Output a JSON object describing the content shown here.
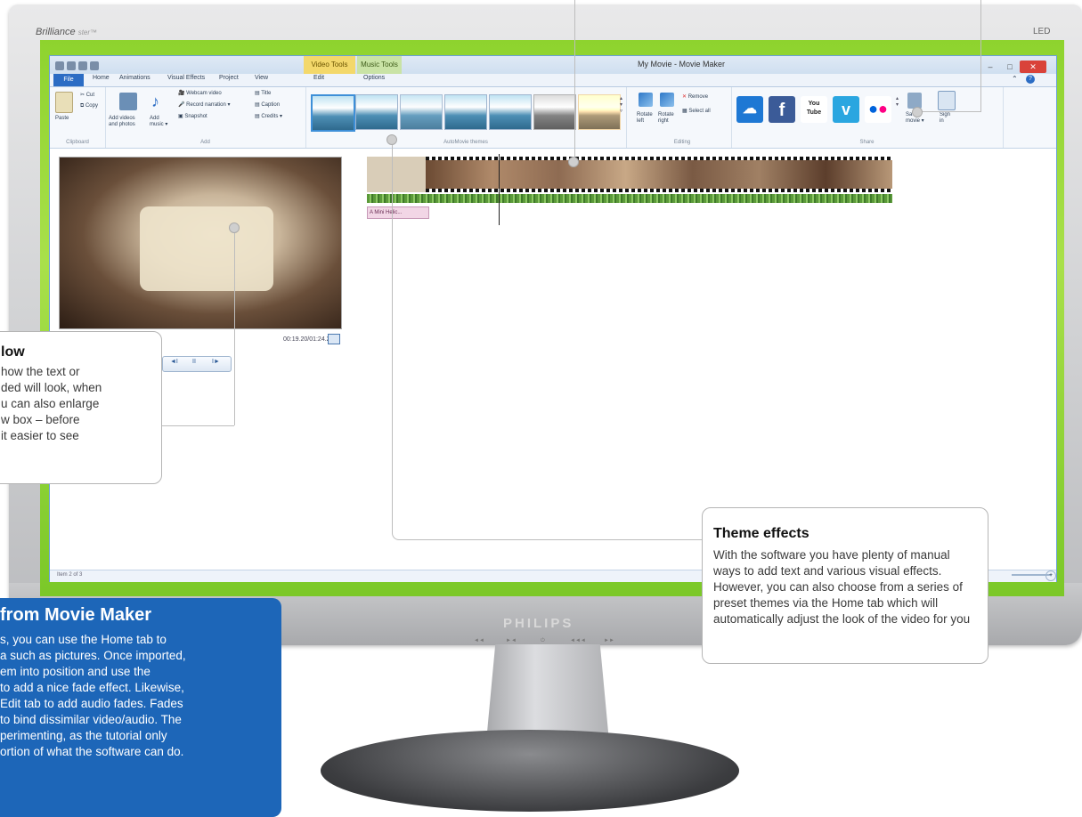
{
  "monitor": {
    "brand_top": "Brilliance",
    "brand_top_suffix": "ster™",
    "led_label": "LED",
    "brand_logo": "PHILIPS",
    "buttons": [
      "◄◄",
      "►◄",
      "⏻",
      "◄◄◄",
      "►►"
    ]
  },
  "window": {
    "title": "My Movie - Movie Maker",
    "context_tabs": [
      "Video Tools",
      "Music Tools"
    ],
    "controls": {
      "minimize": "–",
      "maximize": "□",
      "close": "✕"
    },
    "help_icons": [
      "⌃",
      "?"
    ]
  },
  "tabs": [
    "File",
    "Home",
    "Animations",
    "Visual Effects",
    "Project",
    "View",
    "Edit",
    "Options"
  ],
  "ribbon": {
    "clipboard": {
      "paste": "Paste",
      "cut": "Cut",
      "copy": "Copy",
      "label": "Clipboard"
    },
    "add": {
      "add_videos": "Add videos\nand photos",
      "add_music": "Add\nmusic ▾",
      "webcam": "Webcam video",
      "narration": "Record narration ▾",
      "snapshot": "Snapshot",
      "title": "Title",
      "caption": "Caption",
      "credits": "Credits ▾",
      "label": "Add"
    },
    "themes": {
      "label": "AutoMovie themes",
      "count": 7
    },
    "editing": {
      "rotate_left": "Rotate\nleft",
      "rotate_right": "Rotate\nright",
      "remove": "Remove",
      "select_all": "Select all",
      "label": "Editing"
    },
    "share": {
      "label": "Share",
      "save_movie": "Save\nmovie ▾",
      "sign_in": "Sign\nin",
      "youtube": "You Tube"
    }
  },
  "preview": {
    "time": "00:19.20/01:24.25",
    "controls": [
      "◄I",
      "II",
      "I►"
    ]
  },
  "storyboard": {
    "caption_clip": "A Mini Helic..."
  },
  "status": {
    "text": "Item 2 of 3",
    "zoom_plus": "+"
  },
  "callouts": {
    "preview": {
      "title": "low",
      "lines": [
        "how the text or",
        "ded will look, when",
        "u can also enlarge",
        "w box – before",
        "it easier to see"
      ]
    },
    "theme": {
      "title": "Theme effects",
      "body": "With the software you have plenty of manual ways to add text and various visual effects. However, you can also choose from a series of preset themes via the Home tab which will automatically adjust the look of the video for you"
    },
    "blue": {
      "title": "from Movie Maker",
      "lines": [
        "s, you can use the Home tab to",
        "a such as pictures. Once imported,",
        "em into position and use the",
        "to add a nice fade effect. Likewise,",
        "Edit tab to add audio fades. Fades",
        "to bind dissimilar video/audio. The",
        "perimenting, as the tutorial only",
        "ortion of what the software can do."
      ]
    }
  },
  "colors": {
    "accent": "#2b6cc4",
    "blue_box": "#1d66b8",
    "screen_green": "#8ed32e",
    "video_tools": "#f3d86b"
  }
}
